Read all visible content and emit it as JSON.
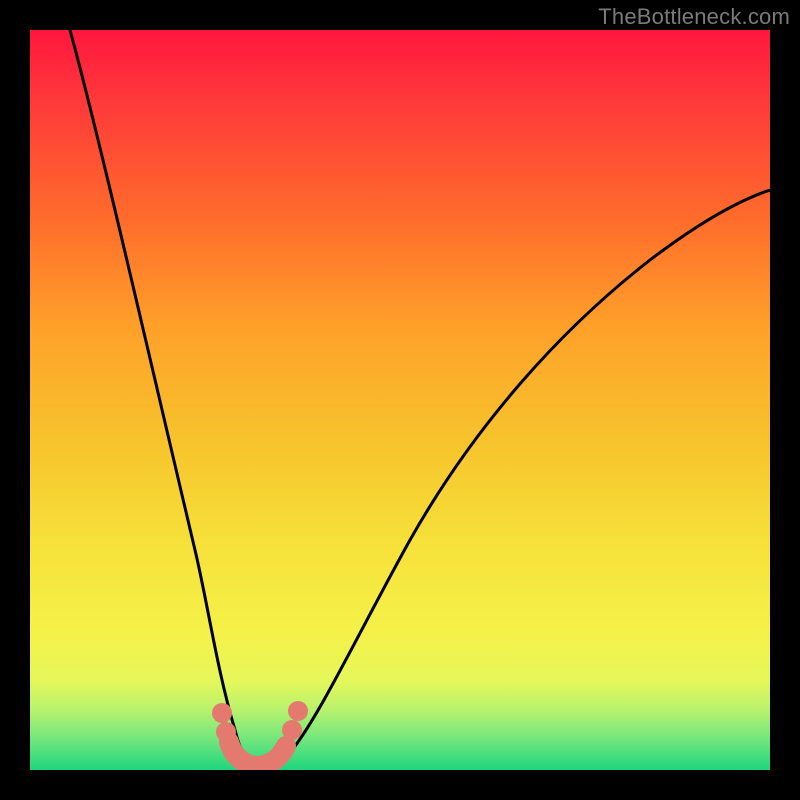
{
  "watermark": "TheBottleneck.com",
  "colors": {
    "frame": "#000000",
    "gradient_top": "#ff173e",
    "gradient_mid": "#f6e23a",
    "gradient_bottom": "#1fd67e",
    "curve": "#000000",
    "marker": "#e47a6f"
  },
  "chart_data": {
    "type": "line",
    "title": "",
    "xlabel": "",
    "ylabel": "",
    "xlim": [
      0,
      100
    ],
    "ylim": [
      0,
      100
    ],
    "grid": false,
    "legend": false,
    "annotations": [
      "TheBottleneck.com"
    ],
    "series": [
      {
        "name": "bottleneck-curve",
        "x": [
          0,
          4,
          8,
          12,
          16,
          18,
          20,
          22,
          24,
          26,
          27,
          28,
          29,
          30,
          31,
          32,
          33,
          35,
          38,
          42,
          48,
          55,
          63,
          72,
          82,
          92,
          100
        ],
        "y": [
          100,
          88,
          76,
          63,
          49,
          41,
          33,
          24,
          14,
          6,
          3,
          1,
          0,
          0,
          0,
          1,
          2,
          5,
          11,
          19,
          30,
          41,
          51,
          60,
          68,
          74,
          78
        ]
      }
    ],
    "markers": {
      "name": "highlight-region",
      "x": [
        25.5,
        26.5,
        27.5,
        29.0,
        30.5,
        32.0,
        33.0,
        34.0
      ],
      "y": [
        8,
        5,
        2,
        0.5,
        0.5,
        1.5,
        3.5,
        7
      ]
    }
  }
}
